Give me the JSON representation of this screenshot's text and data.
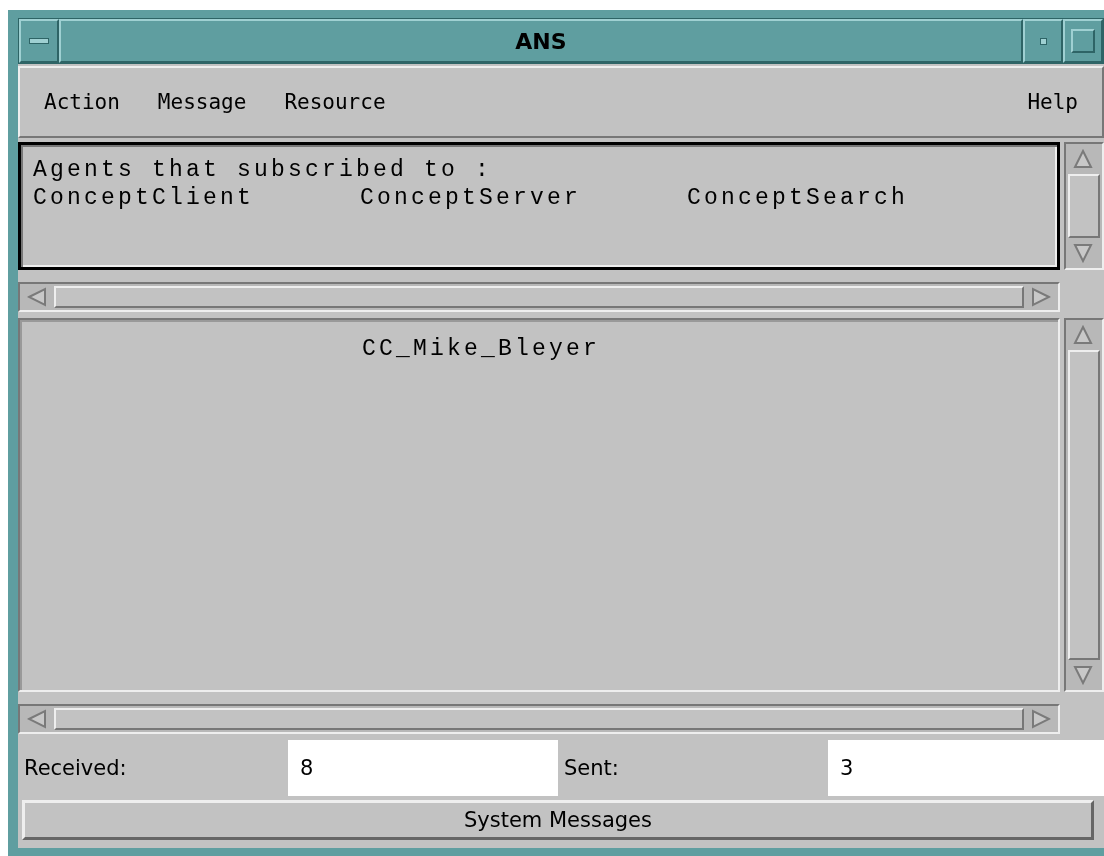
{
  "window": {
    "title": "ANS"
  },
  "menu_bar": {
    "items": [
      "Action",
      "Message",
      "Resource"
    ],
    "help": "Help"
  },
  "subscriptions": {
    "heading": "Agents that subscribed to :",
    "topics": [
      "ConceptClient",
      "ConceptServer",
      "ConceptSearch"
    ]
  },
  "agents": [
    "CC_Mike_Bleyer"
  ],
  "counters": [
    {
      "label": "Received:",
      "value": "8"
    },
    {
      "label": "Sent:",
      "value": "3"
    }
  ],
  "button": "System Messages"
}
